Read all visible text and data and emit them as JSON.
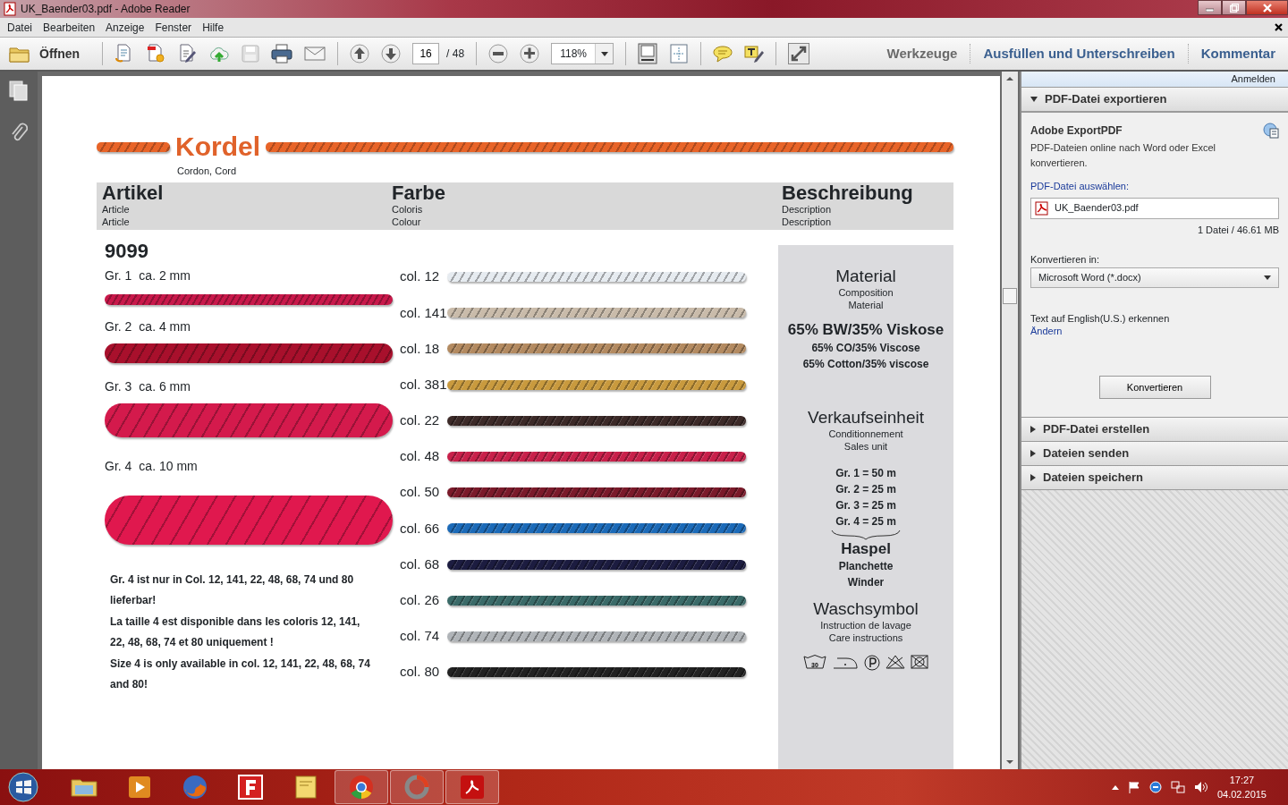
{
  "window": {
    "title": "UK_Baender03.pdf - Adobe Reader"
  },
  "menu": [
    "Datei",
    "Bearbeiten",
    "Anzeige",
    "Fenster",
    "Hilfe"
  ],
  "toolbar": {
    "open": "Öffnen",
    "save": {
      "disabled": true
    },
    "page": "16",
    "page_total": "/ 48",
    "zoom": "118%",
    "panes": [
      {
        "label": "Werkzeuge",
        "kind": "tools"
      },
      {
        "label": "Ausfüllen und Unterschreiben",
        "kind": "pane"
      },
      {
        "label": "Kommentar",
        "kind": "pane"
      }
    ]
  },
  "document": {
    "title": "Kordel",
    "subtitle": "Cordon, Cord",
    "columns": [
      {
        "title": "Artikel",
        "subtitles": [
          "Article",
          "Article"
        ]
      },
      {
        "title": "Farbe",
        "subtitles": [
          "Coloris",
          "Colour"
        ]
      },
      {
        "title": "Beschreibung",
        "subtitles": [
          "Description",
          "Description"
        ]
      }
    ],
    "article": {
      "number": "9099",
      "sizes": [
        {
          "label": "Gr. 1",
          "size": "ca. 2 mm",
          "color": "#c8184a"
        },
        {
          "label": "Gr. 2",
          "size": "ca. 4 mm",
          "color": "#a8102c"
        },
        {
          "label": "Gr. 3",
          "size": "ca. 6 mm",
          "color": "#d41a4c"
        },
        {
          "label": "Gr. 4",
          "size": "ca. 10 mm",
          "color": "#e0184e"
        }
      ],
      "notes": [
        "Gr. 4 ist nur in Col. 12, 141, 22, 48, 68, 74 und 80 lieferbar!",
        "La taille 4 est disponible dans les coloris 12, 141, 22, 48, 68, 74 et 80 uniquement !",
        "Size 4 is only available in col. 12, 141, 22, 48, 68, 74 and 80!"
      ]
    },
    "colors": [
      {
        "label": "col. 12",
        "color": "#e6ebf0"
      },
      {
        "label": "col. 141",
        "color": "#c9bbaa"
      },
      {
        "label": "col. 18",
        "color": "#b38a60"
      },
      {
        "label": "col. 381",
        "color": "#c99a3e"
      },
      {
        "label": "col. 22",
        "color": "#3c2a28"
      },
      {
        "label": "col. 48",
        "color": "#c8204a"
      },
      {
        "label": "col. 50",
        "color": "#7a1a2a"
      },
      {
        "label": "col. 66",
        "color": "#1b6ab8"
      },
      {
        "label": "col. 68",
        "color": "#1c1c40"
      },
      {
        "label": "col. 26",
        "color": "#3a6a68"
      },
      {
        "label": "col. 74",
        "color": "#b0b4b8"
      },
      {
        "label": "col. 80",
        "color": "#222222"
      }
    ],
    "description": {
      "material": {
        "title": "Material",
        "subtitles": [
          "Composition",
          "Material"
        ],
        "values": [
          "65% BW/35% Viskose",
          "65% CO/35% Viscose",
          "65% Cotton/35% viscose"
        ]
      },
      "sales_unit": {
        "title": "Verkaufseinheit",
        "subtitles": [
          "Conditionnement",
          "Sales unit"
        ],
        "values": [
          "Gr. 1 = 50 m",
          "Gr. 2 = 25 m",
          "Gr. 3 = 25 m",
          "Gr. 4 = 25 m"
        ],
        "package": [
          "Haspel",
          "Planchette",
          "Winder"
        ]
      },
      "care": {
        "title": "Waschsymbol",
        "subtitles": [
          "Instruction de lavage",
          "Care instructions"
        ],
        "wash_temperature": "30"
      }
    }
  },
  "right_panel": {
    "sign_in": "Anmelden",
    "sections": [
      {
        "title": "PDF-Datei exportieren",
        "expanded": true
      },
      {
        "title": "PDF-Datei erstellen",
        "expanded": false
      },
      {
        "title": "Dateien senden",
        "expanded": false
      },
      {
        "title": "Dateien speichern",
        "expanded": false
      }
    ],
    "export": {
      "title": "Adobe ExportPDF",
      "text": "PDF-Dateien online nach Word oder Excel konvertieren.",
      "select_label": "PDF-Datei auswählen:",
      "file": "UK_Baender03.pdf",
      "file_info": "1 Datei / 46.61 MB",
      "convert_label": "Konvertieren in:",
      "format": "Microsoft Word (*.docx)",
      "ocr_text": "Text auf English(U.S.) erkennen",
      "change_link": "Ändern",
      "button": "Konvertieren"
    }
  },
  "taskbar": {
    "apps": [
      {
        "kind": "explorer",
        "open": false
      },
      {
        "kind": "media",
        "open": false
      },
      {
        "kind": "firefox",
        "open": false
      },
      {
        "kind": "f-app",
        "open": false
      },
      {
        "kind": "notes",
        "open": false
      },
      {
        "kind": "chrome",
        "open": true
      },
      {
        "kind": "wheel",
        "open": true
      },
      {
        "kind": "reader",
        "open": true
      }
    ],
    "time": "17:27",
    "date": "04.02.2015"
  }
}
